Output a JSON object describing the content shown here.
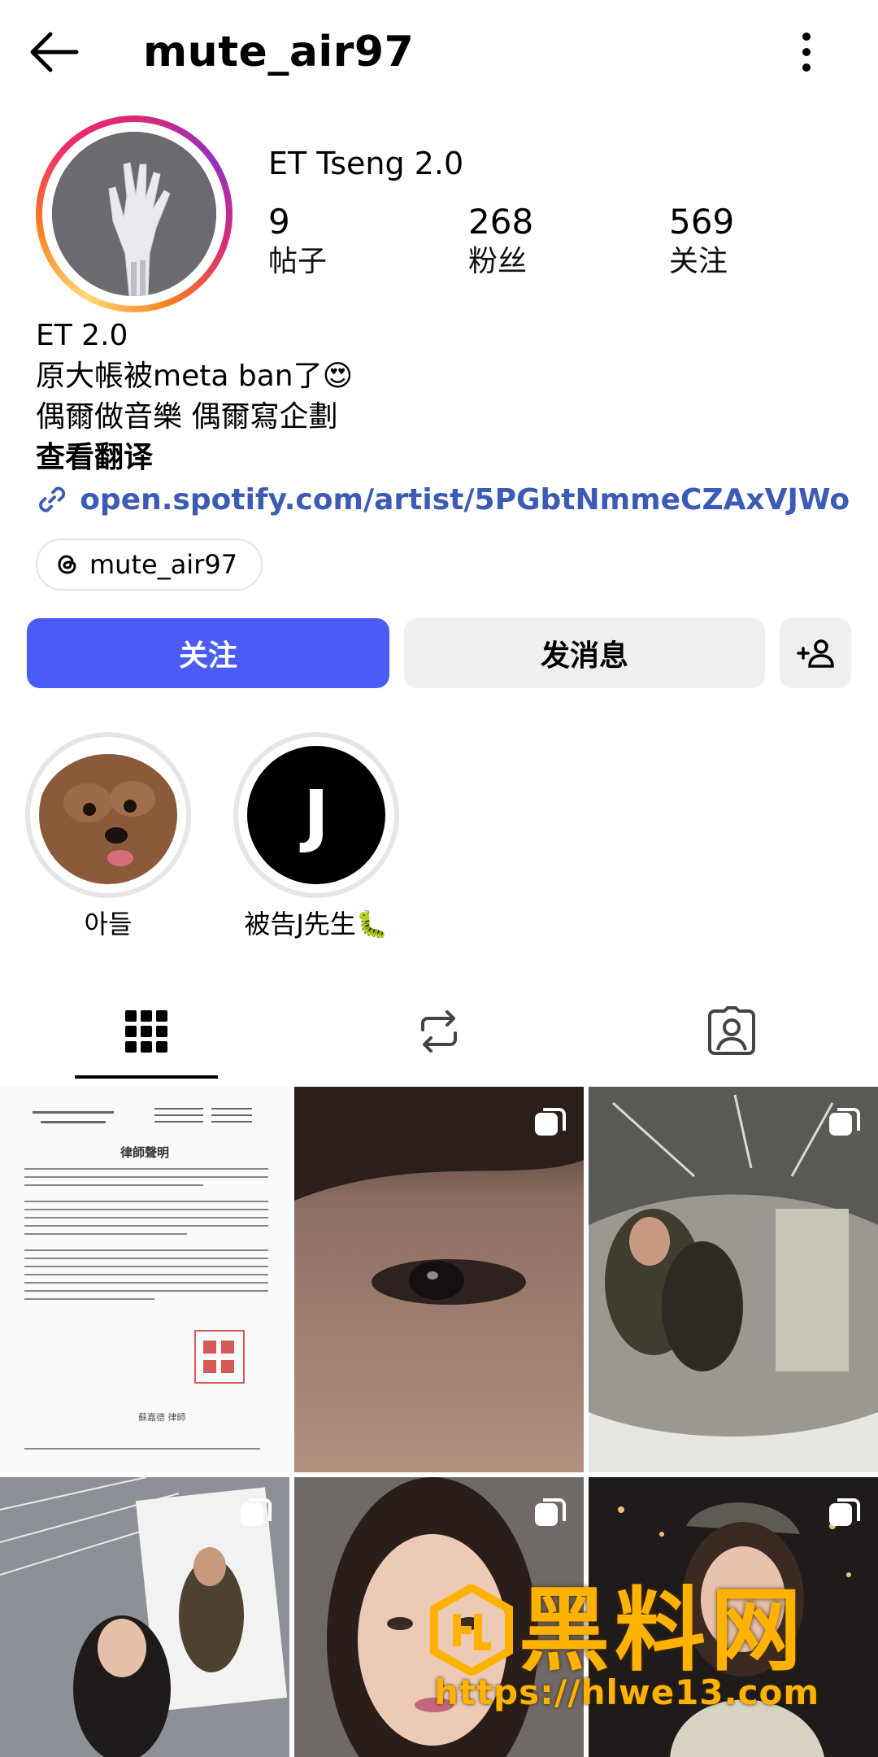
{
  "header": {
    "username": "mute_air97",
    "back_icon": "arrow-left-icon",
    "more_icon": "more-vertical-icon"
  },
  "profile": {
    "display_name": "ET Tseng 2.0",
    "stats": [
      {
        "value": "9",
        "label": "帖子"
      },
      {
        "value": "268",
        "label": "粉丝"
      },
      {
        "value": "569",
        "label": "关注"
      }
    ],
    "bio": {
      "line1": "ET 2.0",
      "line2": "原大帳被meta ban了😍",
      "line3": "偶爾做音樂 偶爾寫企劃",
      "translate": "查看翻译"
    },
    "link": "open.spotify.com/artist/5PGbtNmmeCZAxVJWo...",
    "threads_handle": "mute_air97"
  },
  "actions": {
    "follow": "关注",
    "message": "发消息"
  },
  "highlights": [
    {
      "label": "아들"
    },
    {
      "label": "被告J先生🐛",
      "initial": "J"
    }
  ],
  "tabs": [
    "grid",
    "reels-reposts",
    "tagged"
  ],
  "colors": {
    "follow_button": "#4a5cf5",
    "link": "#3c5bb6",
    "secondary_button": "#efefef"
  },
  "posts": {
    "legal_notice": {
      "title": "律師聲明",
      "signature": "蘇嘉德 律師"
    }
  },
  "watermark": {
    "title": "黑料网",
    "url": "https://hlwe13.com"
  }
}
